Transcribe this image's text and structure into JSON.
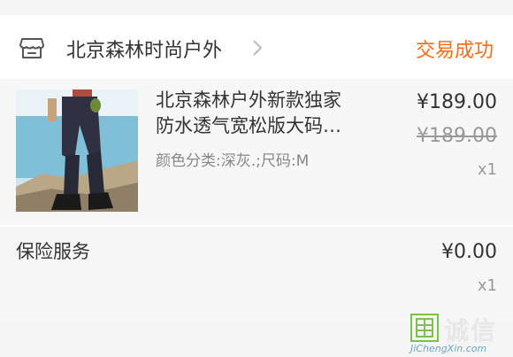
{
  "store": {
    "icon": "store-icon",
    "name": "北京森林时尚户外",
    "status": "交易成功",
    "status_color": "#ff6a12"
  },
  "product": {
    "title_line1": "北京森林户外新款独家",
    "title_line2": "防水透气宽松版大码…",
    "sku": "颜色分类:深灰.;尺码:M",
    "price": "¥189.00",
    "original_price": "¥189.00",
    "quantity": "x1"
  },
  "insurance": {
    "label": "保险服务",
    "price": "¥0.00",
    "quantity": "x1"
  },
  "watermark": {
    "text": "诚信",
    "url": "JiChengXin.com"
  }
}
